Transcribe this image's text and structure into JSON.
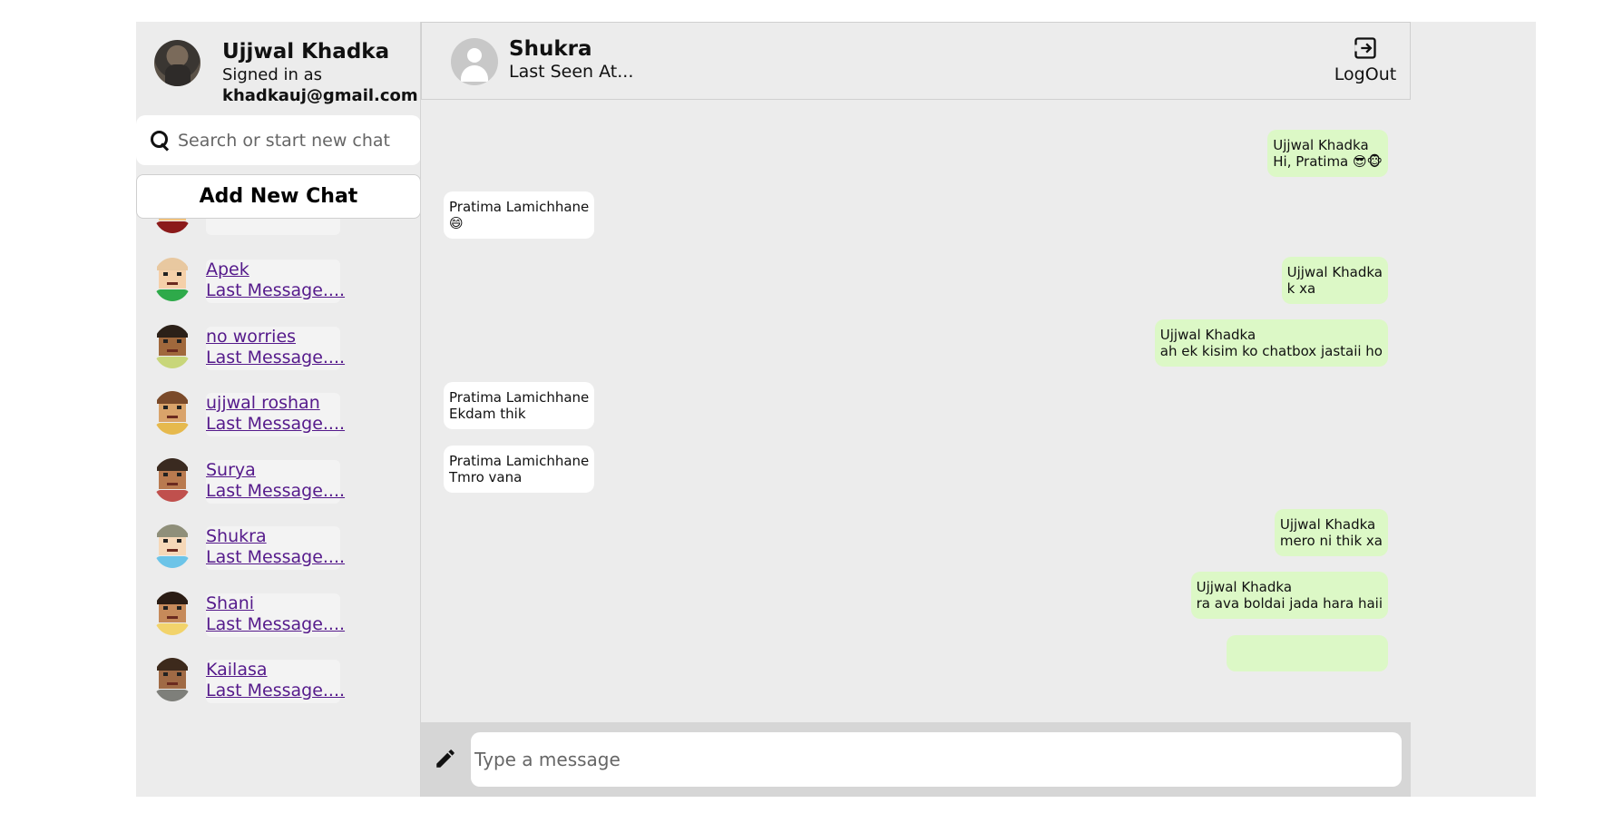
{
  "user": {
    "name": "Ujjwal Khadka",
    "signed_in_label": "Signed in as",
    "email": "khadkauj@gmail.com"
  },
  "search": {
    "placeholder": "Search or start new chat",
    "icon": "search-icon"
  },
  "add_chat_label": "Add New Chat",
  "chats": [
    {
      "name": "",
      "last": "Last Message....",
      "avatar_colors": {
        "hair": "#6b2b22",
        "face": "#f1c27d",
        "shirt": "#8b1a1a"
      }
    },
    {
      "name": "Apek",
      "last": "Last Message....",
      "avatar_colors": {
        "hair": "#e8c8a0",
        "face": "#f5d0a9",
        "shirt": "#2eaa4a"
      }
    },
    {
      "name": "no worries",
      "last": "Last Message....",
      "avatar_colors": {
        "hair": "#2b2018",
        "face": "#a0683c",
        "shirt": "#c8d67a"
      }
    },
    {
      "name": "ujjwal roshan",
      "last": "Last Message....",
      "avatar_colors": {
        "hair": "#7a4a2a",
        "face": "#d9a36a",
        "shirt": "#e6b94d"
      }
    },
    {
      "name": "Surya",
      "last": "Last Message....",
      "avatar_colors": {
        "hair": "#3a2a20",
        "face": "#b97a4f",
        "shirt": "#c0504d"
      }
    },
    {
      "name": "Shukra",
      "last": "Last Message....",
      "avatar_colors": {
        "hair": "#8f8f7a",
        "face": "#f6d8b8",
        "shirt": "#6cc4e8"
      }
    },
    {
      "name": "Shani",
      "last": "Last Message....",
      "avatar_colors": {
        "hair": "#2a1c14",
        "face": "#c68a5a",
        "shirt": "#f2d36b"
      }
    },
    {
      "name": "Kailasa",
      "last": "Last Message....",
      "avatar_colors": {
        "hair": "#3d2a1c",
        "face": "#a06a45",
        "shirt": "#7e7f7a"
      }
    }
  ],
  "header": {
    "contact_name": "Shukra",
    "last_seen": "Last Seen At...",
    "logout_label": "LogOut"
  },
  "messages": [
    {
      "dir": "out",
      "sender": "Ujjwal Khadka",
      "text": "Hi, Pratima 😎🐵"
    },
    {
      "dir": "in",
      "sender": "Pratima Lamichhane",
      "text": "😄"
    },
    {
      "dir": "out",
      "sender": "Ujjwal Khadka",
      "text": "k xa"
    },
    {
      "dir": "out",
      "sender": "Ujjwal Khadka",
      "text": "ah ek kisim ko chatbox jastaii ho"
    },
    {
      "dir": "in",
      "sender": "Pratima Lamichhane",
      "text": "Ekdam thik"
    },
    {
      "dir": "in",
      "sender": "Pratima Lamichhane",
      "text": "Tmro vana"
    },
    {
      "dir": "out",
      "sender": "Ujjwal Khadka",
      "text": "mero ni thik xa"
    },
    {
      "dir": "out",
      "sender": "Ujjwal Khadka",
      "text": "ra ava boldai jada hara haii"
    }
  ],
  "composer": {
    "placeholder": "Type a message"
  },
  "colors": {
    "app_bg": "#ececec",
    "outgoing_bubble": "#dcf8c6",
    "incoming_bubble": "#ffffff",
    "link": "#551a8b"
  }
}
